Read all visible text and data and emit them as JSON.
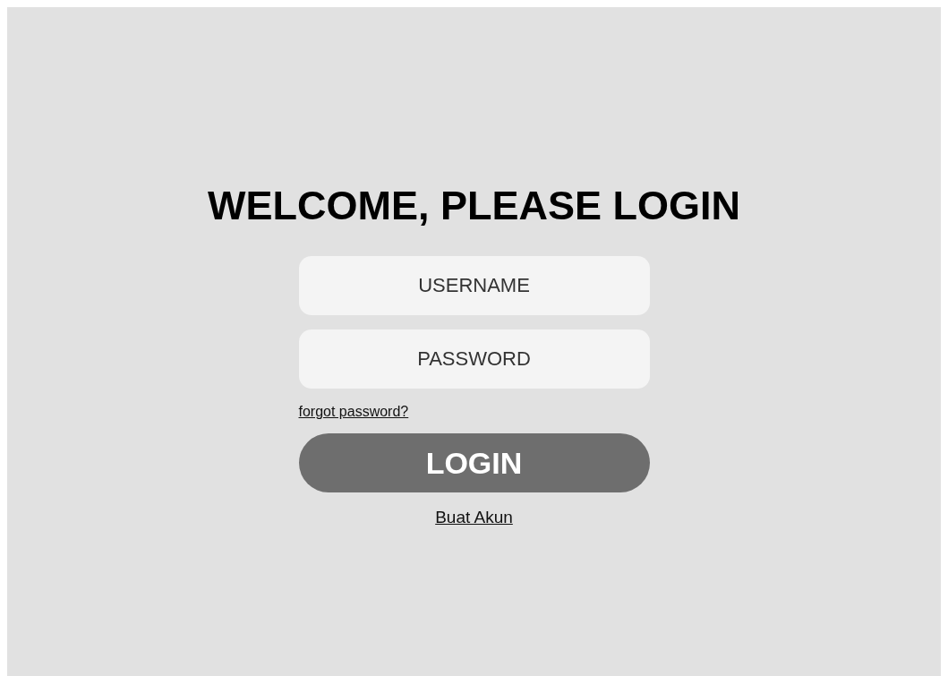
{
  "title": "WELCOME, PLEASE LOGIN",
  "fields": [
    {
      "placeholder": "USERNAME"
    },
    {
      "placeholder": "PASSWORD"
    }
  ],
  "forgot_link": "forgot password?",
  "login_button": "LOGIN",
  "register_link": "Buat Akun"
}
